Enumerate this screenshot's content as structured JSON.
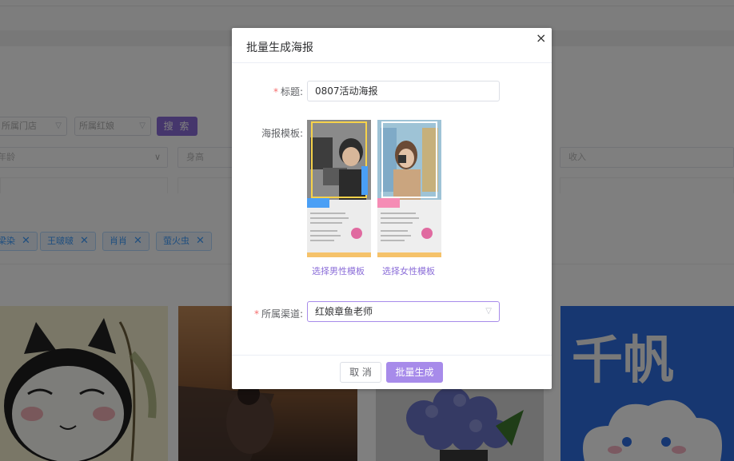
{
  "background": {
    "filters": {
      "store_placeholder": "所属门店",
      "matchmaker_placeholder": "所属红娘",
      "search_label": "搜 索",
      "age_placeholder": "年龄",
      "height_placeholder": "身高",
      "income_placeholder": "收入"
    },
    "tags": [
      "梁染",
      "王啵啵",
      "肖肖",
      "萤火虫"
    ],
    "cards": [
      {
        "kind": "cartoon-cat"
      },
      {
        "kind": "sunset-photo"
      },
      {
        "kind": "flower-photo"
      },
      {
        "kind": "logo",
        "text": "千帆"
      }
    ]
  },
  "dialog": {
    "title": "批量生成海报",
    "close_label": "×",
    "fields": {
      "title_label": "标题:",
      "title_value": "0807活动海报",
      "template_label": "海报模板:",
      "channel_label": "所属渠道:",
      "channel_value": "红娘章鱼老师"
    },
    "templates": [
      {
        "link": "选择男性模板",
        "accent": "#4a9ff5"
      },
      {
        "link": "选择女性模板",
        "accent": "#f58cb5"
      }
    ],
    "buttons": {
      "cancel": "取 消",
      "confirm": "批量生成"
    }
  },
  "colors": {
    "primary": "#a78bea",
    "required": "#f56c6c",
    "tag_blue": "#409eff"
  }
}
